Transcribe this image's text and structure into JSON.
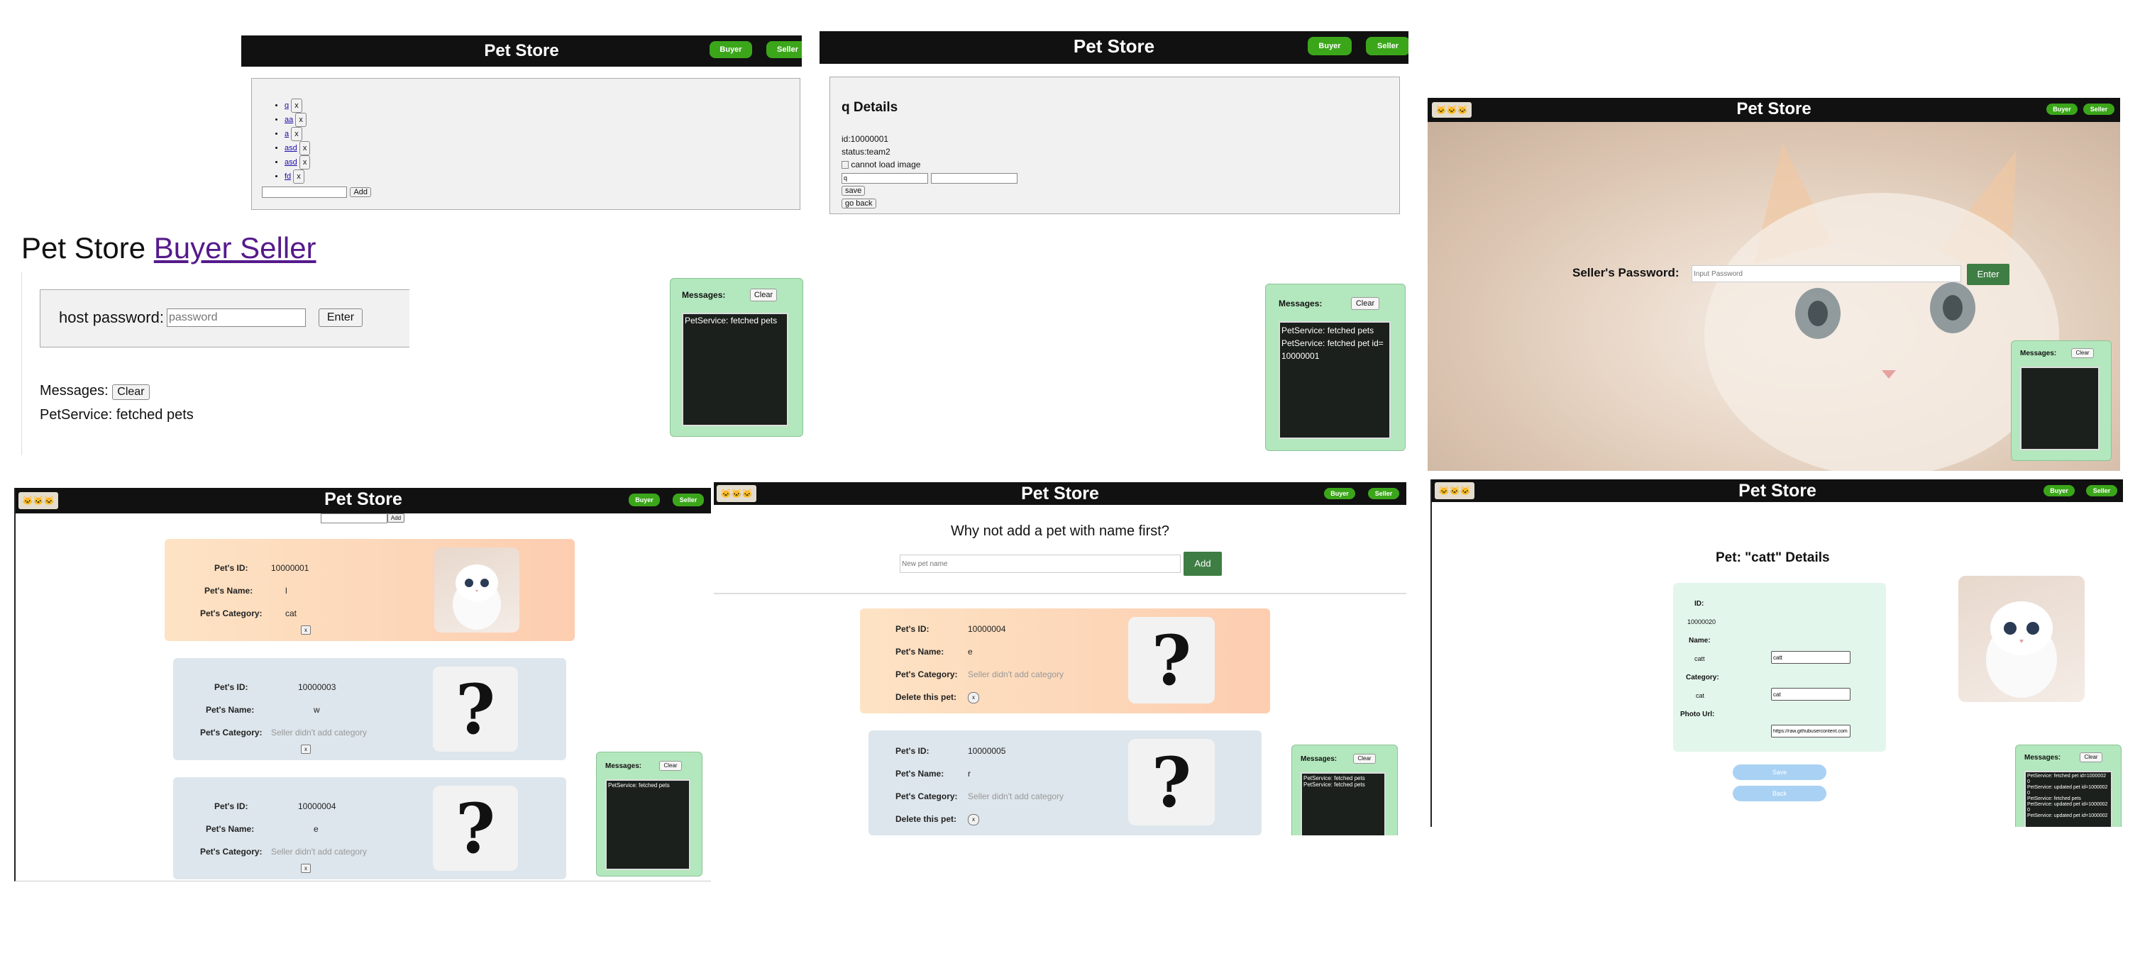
{
  "app": {
    "title": "Pet Store",
    "buyer": "Buyer",
    "seller": "Seller",
    "logo_text": "🐱🐱🐱"
  },
  "panel1": {
    "pets": [
      "q",
      "aa",
      "a",
      "asd",
      "asd",
      "fd"
    ],
    "delete_label": "x",
    "add_label": "Add"
  },
  "panel2": {
    "heading": "q Details",
    "id_line": "id:10000001",
    "status_line": "status:team2",
    "img_alt": "cannot load image",
    "name_value": "q",
    "save_label": "save",
    "back_label": "go back",
    "messages_label": "Messages:",
    "clear_label": "Clear",
    "log": [
      "PetService: fetched pets",
      "PetService: fetched pet id=10000001"
    ]
  },
  "panel3": {
    "heading_title": "Pet Store",
    "heading_link": "Buyer Seller",
    "password_label": "host password:",
    "password_placeholder": "password",
    "enter_label": "Enter",
    "messages_label": "Messages:",
    "clear_label": "Clear",
    "message": "PetService: fetched pets"
  },
  "panel1_messages": {
    "label": "Messages:",
    "clear": "Clear",
    "log": [
      "PetService: fetched pets"
    ]
  },
  "panel4": {
    "password_label": "Seller's Password:",
    "password_placeholder": "Input Password",
    "enter_label": "Enter",
    "messages_label": "Messages:",
    "clear_label": "Clear"
  },
  "panel5": {
    "add_label": "Add",
    "labels": {
      "id": "Pet's ID:",
      "name": "Pet's Name:",
      "category": "Pet's Category:"
    },
    "pets": [
      {
        "id": "10000001",
        "name": "l",
        "category": "cat"
      },
      {
        "id": "10000003",
        "name": "w",
        "category": "Seller didn't add category"
      },
      {
        "id": "10000004",
        "name": "e",
        "category": "Seller didn't add category"
      }
    ],
    "delete_label": "x",
    "messages_label": "Messages:",
    "clear_label": "Clear",
    "log": [
      "PetService: fetched pets"
    ]
  },
  "panel6": {
    "question": "Why not add a pet with name first?",
    "input_placeholder": "New pet name",
    "add_label": "Add",
    "labels": {
      "id": "Pet's ID:",
      "name": "Pet's Name:",
      "category": "Pet's Category:",
      "delete": "Delete this pet:"
    },
    "pets": [
      {
        "id": "10000004",
        "name": "e",
        "category": "Seller didn't add category"
      },
      {
        "id": "10000005",
        "name": "r",
        "category": "Seller didn't add category"
      }
    ],
    "delete_label": "x",
    "messages_label": "Messages:",
    "clear_label": "Clear",
    "log": [
      "PetService: fetched pets",
      "PetService: fetched pets"
    ]
  },
  "panel7": {
    "heading": "Pet: \"catt\" Details",
    "id_label": "ID:",
    "id_value": "10000020",
    "name_label": "Name:",
    "name_value": "catt",
    "category_label": "Category:",
    "category_value": "cat",
    "photo_label": "Photo Url:",
    "photo_value": "https://raw.githubusercontent.com",
    "save_label": "Save",
    "back_label": "Back",
    "messages_label": "Messages:",
    "clear_label": "Clear",
    "log": [
      "PetService: fetched pet id=1000002",
      "0",
      "PetService: updated pet id=1000002",
      "0",
      "PetService: fetched pets",
      "PetService: updated pet id=1000002",
      "0",
      "PetService: updated pet id=1000002"
    ]
  },
  "colors": {
    "header": "#111111",
    "green_button": "#3ba61a",
    "dark_green": "#3e7d43",
    "messages_bg": "#b3e7bd",
    "card_peach": "#fdd8b6",
    "card_blue": "#dde6ec",
    "detail_bg": "#e3f6ec",
    "blue_button": "#a9d1f3"
  }
}
